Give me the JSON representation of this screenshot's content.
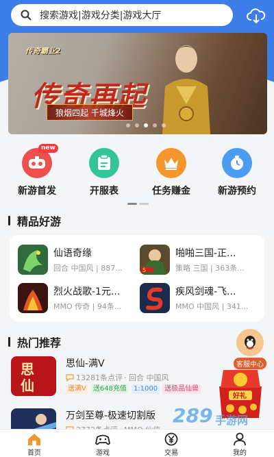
{
  "search": {
    "placeholder": "搜索游戏|游戏分类|游戏大厅"
  },
  "banner": {
    "logo": "传奇霸业2",
    "title": "传奇再起",
    "subtitle": "狼烟四起  千城烽火"
  },
  "quick": [
    {
      "label": "新游首发",
      "badge": "new",
      "color": "#ee4f4f",
      "icon": "gamepad-icon"
    },
    {
      "label": "开服表",
      "color": "#33c49a",
      "icon": "server-list-icon"
    },
    {
      "label": "任务赚金",
      "color": "#f6962e",
      "icon": "crown-icon"
    },
    {
      "label": "新游预约",
      "color": "#4a9df0",
      "icon": "alarm-clock-icon"
    }
  ],
  "featured": {
    "title": "精品好游",
    "games": [
      {
        "name": "仙语奇缘",
        "meta": "回合 中国风 | 887..."
      },
      {
        "name": "啪啪三国-正...",
        "meta": "策略 三国 | 363条..."
      },
      {
        "name": "烈火战歌-1元...",
        "meta": "MMO 传奇 | 94条..."
      },
      {
        "name": "疾风剑魂-飞...",
        "meta": "MMO 中国风 | 341..."
      }
    ]
  },
  "hot": {
    "title": "热门推荐",
    "items": [
      {
        "name": "思仙-满V",
        "comments": "13281条点评",
        "meta": "· 回合 中国风",
        "tags": [
          {
            "text": "送满V",
            "bg": "#fdeee0",
            "fg": "#e58a3a"
          },
          {
            "text": "送648充值",
            "bg": "#e3f5e6",
            "fg": "#3aa356"
          },
          {
            "text": "1:1000",
            "bg": "#e4effc",
            "fg": "#4a86d6"
          },
          {
            "text": "送极品仙兽",
            "bg": "#fbe4ea",
            "fg": "#d9466e"
          }
        ]
      },
      {
        "name": "万剑至尊-极速切割版",
        "comments": "3772条点评",
        "meta": "· MMO 仙侠",
        "tags": []
      }
    ]
  },
  "customer_service": {
    "label": "客服中心"
  },
  "gift": {
    "label": "好礼"
  },
  "watermark": {
    "number": "289",
    "site": "手游网"
  },
  "tabbar": [
    {
      "label": "首页",
      "icon": "home-icon",
      "active": true
    },
    {
      "label": "游戏",
      "icon": "game-controller-icon",
      "active": false
    },
    {
      "label": "交易",
      "icon": "yuan-trade-icon",
      "active": false
    },
    {
      "label": "我的",
      "icon": "user-icon",
      "active": false
    }
  ],
  "colors": {
    "brand_blue": "#3d7ee8",
    "accent_orange": "#f6962e"
  }
}
